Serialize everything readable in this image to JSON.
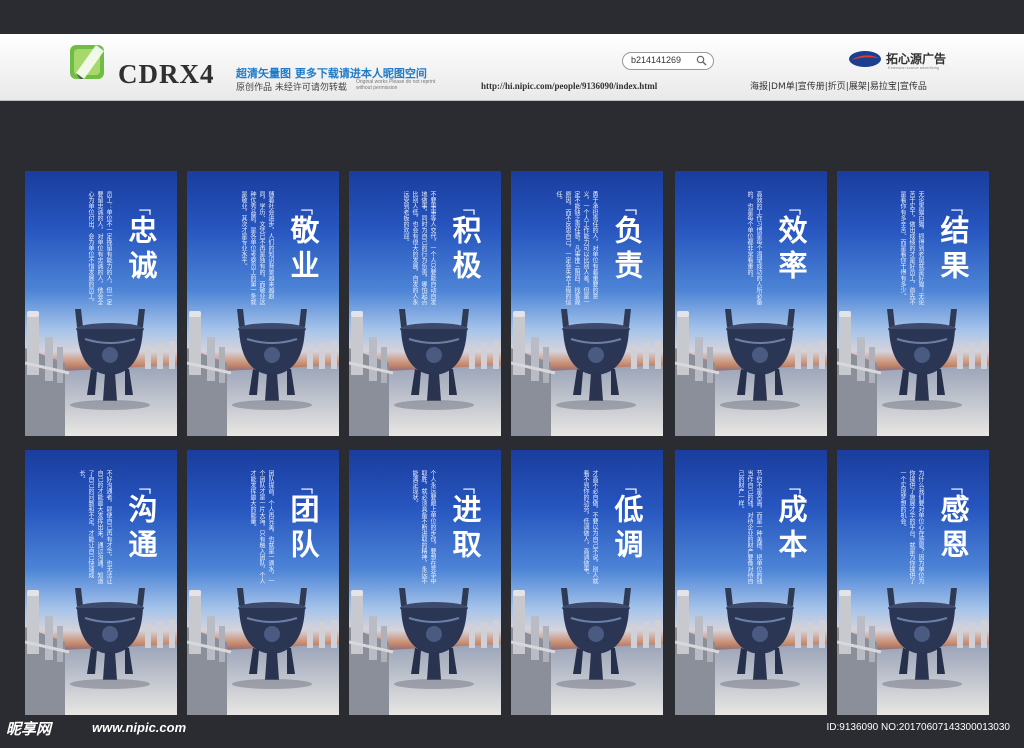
{
  "header": {
    "logo_text": "CDRX4",
    "promo_line1": "超清矢量图 更多下载请进本人昵图空间",
    "promo_line2": "原创作品 未经许可请勿转载",
    "promo_small": "Original works Please do not reprint without permission",
    "search_value": "b214141269",
    "url": "http://hi.nipic.com/people/9136090/index.html",
    "brand_name": "拓心源广告",
    "brand_sub": "Extension source advertising",
    "services": "海报|DM单|宣传册|折页|展架|易拉宝|宣传品"
  },
  "posters": [
    {
      "title": "忠诚",
      "text": "员工：单位不一定挽留有能力的人，但一定要留忠诚的人，对单位有忠诚的人，他会全心为单位付出，会为单位不惜发展的员工。"
    },
    {
      "title": "敬业",
      "text": "随着社会进步，人们的知识背景越来越趋同，学历、文凭已不再是独有的，而敬业这种优秀品质，是各单位考察员工的第一条就是敬业，其次才是专业水平。"
    },
    {
      "title": "积极",
      "text": "不要事事等人交代，一个人只要能自动自发地做事，同时为自己的行为负责，哪怕起点比别人低，也会有很大的发展，自发的人永远受到老板的欢迎。"
    },
    {
      "title": "负责",
      "text": "勇于承担责任的人，对单位有着重要的意义，一个人工作能力可以比别人差，但是一定不能缺乏责任感，凡事推三阻四、找客观原因，而不反思自己，一定会失去上级的信任。"
    },
    {
      "title": "效率",
      "text": "高效的工作习惯是每个渴望成功的人所必备的，也是每个单位都非常看重的。"
    },
    {
      "title": "结果",
      "text": "无论黑猫白猫，抓得到老鼠就是好猫！无论苦干实干，做出成绩的才是好员工，首先不是看你有多辛苦、而是看你干得有多少。"
    },
    {
      "title": "沟通",
      "text": "不好沟通者，即便自己再有才华，也无法让自己的才能最大发挥出来，通过沟通，知道了自己的问题和不足，才能让自己快速成长。"
    },
    {
      "title": "团队",
      "text": "团队提前，个人再完美，也就是一滴水，一个团队才是一片大海，只有融入团队，个人才能发挥最大的能量。"
    },
    {
      "title": "进取",
      "text": "个人永远要跟上单位的步伐，要想在竞争中取胜，就必须具备不断进取的精神，永远不能满足现状。"
    },
    {
      "title": "低调",
      "text": "才高不必自傲，不要以为自己不说，别人就看不到你的功劳，低调做人，高调做事。"
    },
    {
      "title": "成本",
      "text": "节约不是吝啬，而是一种美德，把单位的钱当作自己的钱，对待企业的财产要像对待自己的财产一样。"
    },
    {
      "title": "感恩",
      "text": "为什么我们要对单位心存感恩？因为单位为你提供了施展才华的平台，就是为你提供了一个实现梦想的机会。"
    }
  ],
  "footer": {
    "site_logo": "昵享网",
    "site_url": "www.nipic.com",
    "id_text": "ID:9136090 NO:20170607143300013030"
  }
}
